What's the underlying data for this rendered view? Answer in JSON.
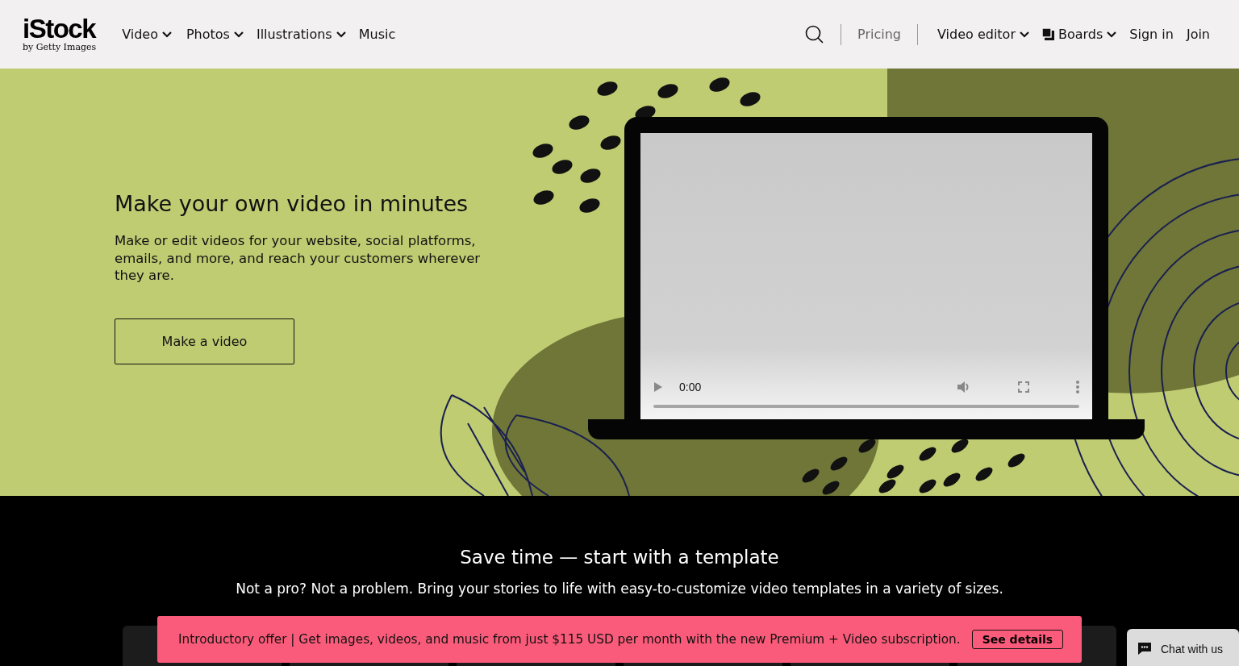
{
  "header": {
    "logo": {
      "brand": "iStock",
      "tagline": "by Getty Images"
    },
    "nav_left": [
      {
        "label": "Video",
        "dropdown": true
      },
      {
        "label": "Photos",
        "dropdown": true
      },
      {
        "label": "Illustrations",
        "dropdown": true
      },
      {
        "label": "Music",
        "dropdown": false
      }
    ],
    "pricing": "Pricing",
    "nav_right": [
      {
        "label": "Video editor",
        "dropdown": true,
        "kind": "menu"
      },
      {
        "label": "Boards",
        "dropdown": true,
        "kind": "boards"
      },
      {
        "label": "Sign in",
        "dropdown": false,
        "kind": "link"
      },
      {
        "label": "Join",
        "dropdown": false,
        "kind": "link"
      }
    ]
  },
  "hero": {
    "title": "Make your own video in minutes",
    "text": "Make or edit videos for your website, social platforms, emails, and more, and reach your customers wherever they are.",
    "button": "Make a video",
    "video": {
      "time": "0:00"
    }
  },
  "templates": {
    "title": "Save time — start with a template",
    "text": "Not a pro? Not a problem. Bring your stories to life with easy-to-customize video templates in a variety of sizes."
  },
  "banner": {
    "text": "Introductory offer | Get images, videos, and music from just $115 USD per month with the new Premium + Video subscription.",
    "button": "See details"
  },
  "chat": {
    "label": "Chat with us"
  }
}
